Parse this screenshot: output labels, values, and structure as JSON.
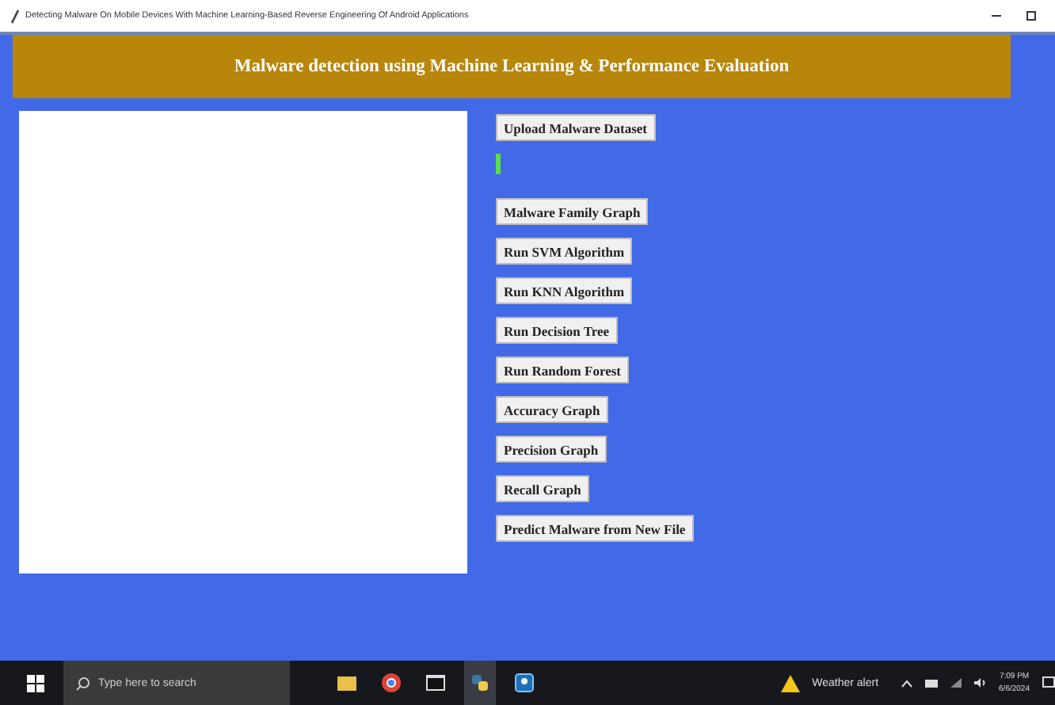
{
  "window": {
    "title": "Detecting Malware On Mobile Devices With Machine Learning-Based Reverse Engineering Of Android Applications"
  },
  "header": {
    "title": "Malware detection using Machine Learning & Performance Evaluation"
  },
  "buttons": [
    "Upload Malware Dataset",
    "Malware Family Graph",
    "Run SVM Algorithm",
    "Run KNN Algorithm",
    "Run Decision Tree",
    "Run Random Forest",
    "Accuracy Graph",
    "Precision Graph",
    "Recall Graph",
    "Predict Malware from New File"
  ],
  "taskbar": {
    "search": {
      "placeholder": "Type here to search"
    },
    "weather": "Weather alert",
    "time": "7:09 PM",
    "date": "6/6/2024"
  }
}
